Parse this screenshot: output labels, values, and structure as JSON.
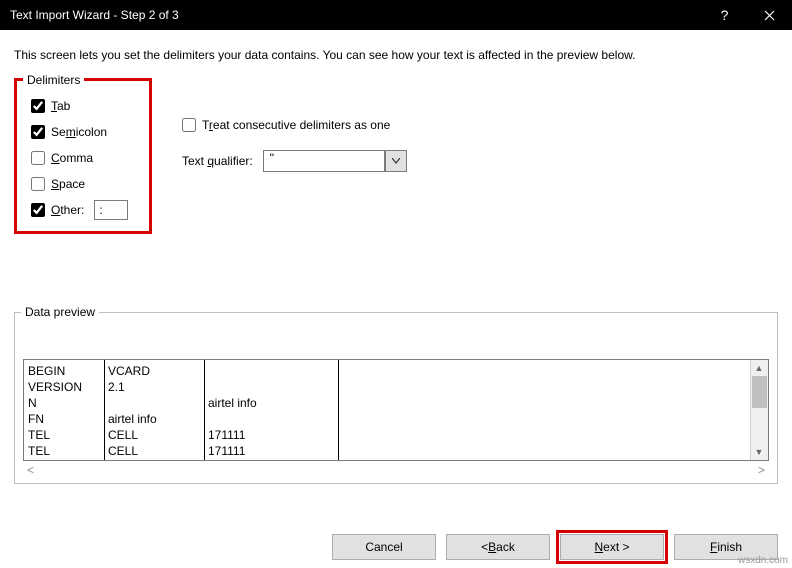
{
  "window": {
    "title": "Text Import Wizard - Step 2 of 3"
  },
  "intro": "This screen lets you set the delimiters your data contains.  You can see how your text is affected in the preview below.",
  "delimiters": {
    "legend": "Delimiters",
    "tab": {
      "label_pre": "",
      "label_mn": "T",
      "label_post": "ab",
      "checked": true
    },
    "semicolon": {
      "label_pre": "Se",
      "label_mn": "m",
      "label_post": "icolon",
      "checked": true
    },
    "comma": {
      "label_pre": "",
      "label_mn": "C",
      "label_post": "omma",
      "checked": false
    },
    "space": {
      "label_pre": "",
      "label_mn": "S",
      "label_post": "pace",
      "checked": false
    },
    "other": {
      "label_pre": "",
      "label_mn": "O",
      "label_post": "ther:",
      "checked": true,
      "value": ":"
    }
  },
  "options": {
    "treat_consecutive": {
      "label_pre": "T",
      "label_mn": "r",
      "label_post": "eat consecutive delimiters as one",
      "checked": false
    },
    "qualifier_label_pre": "Text ",
    "qualifier_label_mn": "q",
    "qualifier_label_post": "ualifier:",
    "qualifier_value": "\""
  },
  "preview": {
    "legend": "Data preview",
    "col1": "BEGIN\nVERSION\nN\nFN\nTEL\nTEL",
    "col2": "VCARD\n2.1\n\nairtel info\nCELL\nCELL",
    "col3": "\n\nairtel info\n\n171111\n171111"
  },
  "buttons": {
    "cancel": "Cancel",
    "back_pre": "< ",
    "back_mn": "B",
    "back_post": "ack",
    "next_pre": "",
    "next_mn": "N",
    "next_post": "ext >",
    "finish_pre": "",
    "finish_mn": "F",
    "finish_post": "inish"
  },
  "watermark": "wsxdn.com"
}
